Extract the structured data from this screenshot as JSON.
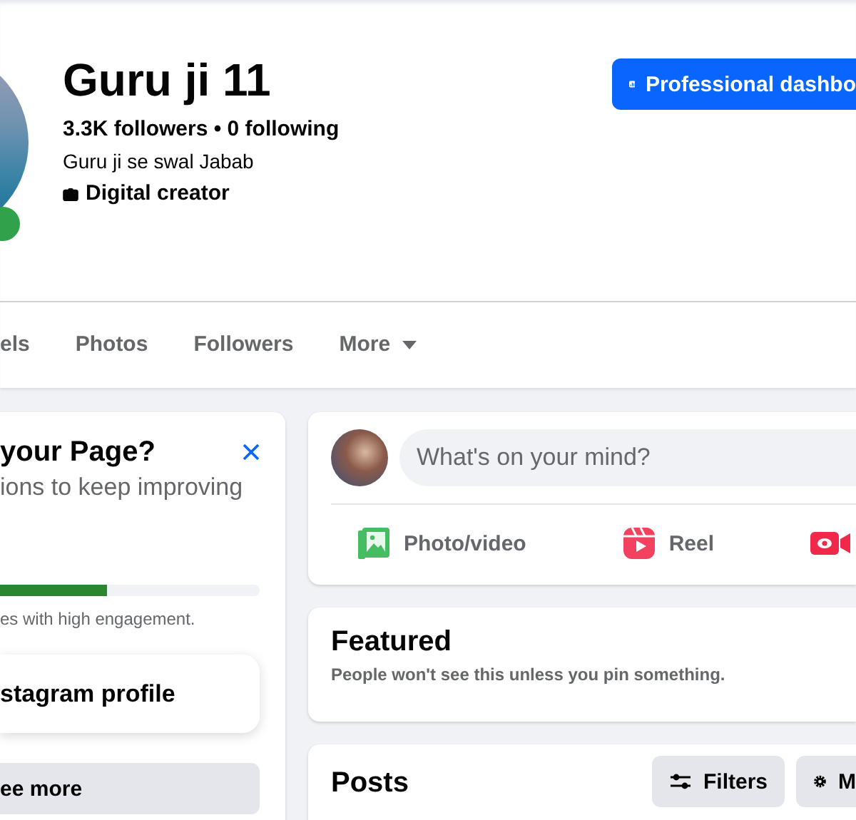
{
  "profile": {
    "name": "Guru ji 11",
    "stats": "3.3K followers • 0 following",
    "bio": "Guru ji se swal Jabab",
    "category": "Digital creator",
    "online": true
  },
  "dashboard_button": {
    "label": "Professional dashbo"
  },
  "tabs": [
    {
      "label": "els",
      "selected": false,
      "kind": "tab"
    },
    {
      "label": "Photos",
      "selected": false,
      "kind": "tab"
    },
    {
      "label": "Followers",
      "selected": false,
      "kind": "tab"
    },
    {
      "label": "More",
      "selected": false,
      "kind": "menu"
    }
  ],
  "setup_card": {
    "title": "your Page?",
    "subtitle": "ions to keep improving",
    "progress": {
      "level": 0.41
    },
    "note": "es with high engagement.",
    "item": "stagram profile",
    "see_more": "ee more"
  },
  "composer": {
    "placeholder": "What's on your mind?",
    "actions": [
      {
        "kind": "photo",
        "label": "Photo/video"
      },
      {
        "kind": "reel",
        "label": "Reel"
      },
      {
        "kind": "live"
      }
    ]
  },
  "featured": {
    "title": "Featured",
    "description": "People won't see this unless you pin something."
  },
  "posts": {
    "title": "Posts",
    "buttons": [
      {
        "kind": "filters",
        "label": "Filters"
      },
      {
        "kind": "manage",
        "label": "M"
      }
    ]
  }
}
